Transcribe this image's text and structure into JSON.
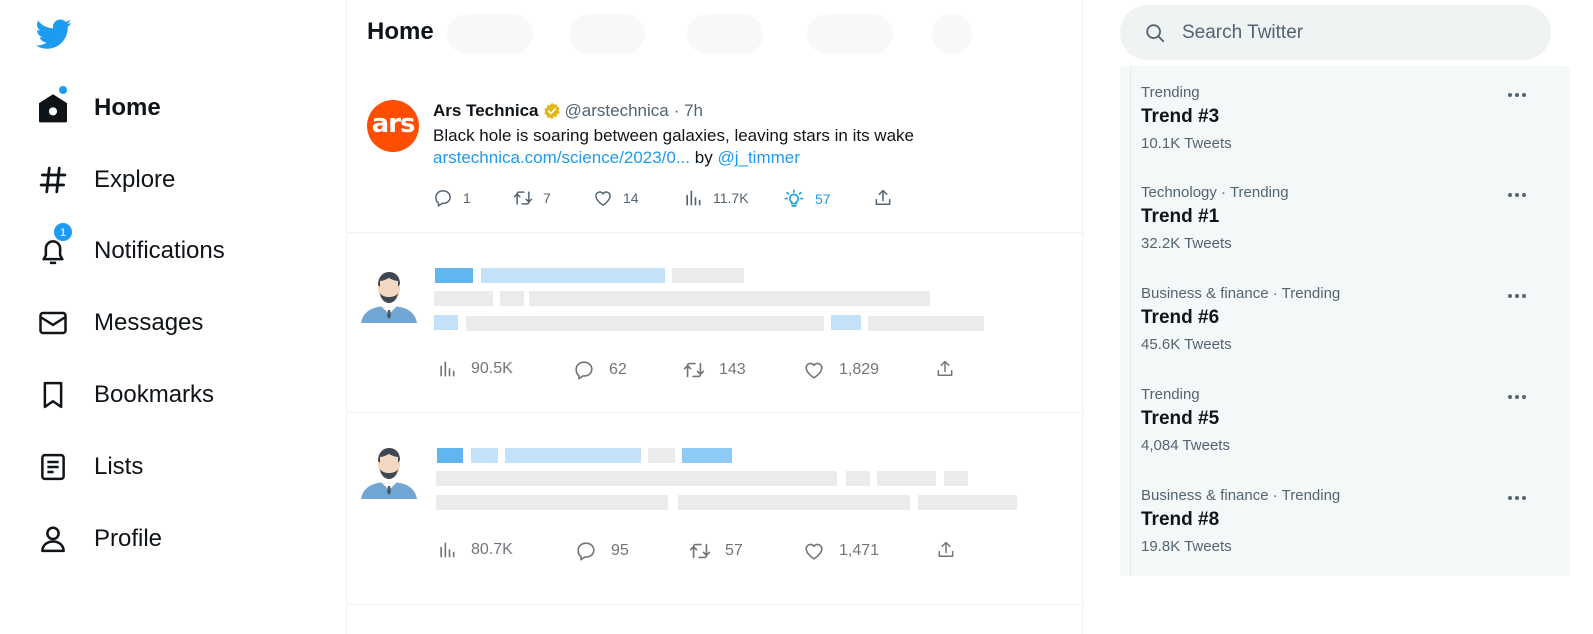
{
  "colors": {
    "accent": "#1d9bf0",
    "ars_orange": "#ff4e00",
    "muted": "#536471"
  },
  "sidebar": {
    "logo_icon": "twitter-bird-icon",
    "items": [
      {
        "label": "Home",
        "icon": "home-icon",
        "active": true,
        "dot": true
      },
      {
        "label": "Explore",
        "icon": "hashtag-icon"
      },
      {
        "label": "Notifications",
        "icon": "bell-icon",
        "badge": "1"
      },
      {
        "label": "Messages",
        "icon": "envelope-icon"
      },
      {
        "label": "Bookmarks",
        "icon": "bookmark-icon"
      },
      {
        "label": "Lists",
        "icon": "list-icon"
      },
      {
        "label": "Profile",
        "icon": "person-icon"
      }
    ]
  },
  "main": {
    "title": "Home",
    "tweet": {
      "avatar_text": "ars",
      "name": "Ars Technica",
      "handle": "@arstechnica",
      "time": "· 7h",
      "text": "Black hole is soaring between galaxies, leaving stars in its wake",
      "link": "arstechnica.com/science/2023/0...",
      "by": "by",
      "mention": "@j_timmer",
      "stats": {
        "replies": "1",
        "retweets": "7",
        "likes": "14",
        "views": "11.7K",
        "tips": "57"
      }
    },
    "placeholder_tweets": [
      {
        "views": "90.5K",
        "replies": "62",
        "retweets": "143",
        "likes": "1,829"
      },
      {
        "views": "80.7K",
        "replies": "95",
        "retweets": "57",
        "likes": "1,471"
      }
    ]
  },
  "search": {
    "placeholder": "Search Twitter"
  },
  "trends": [
    {
      "category": "Trending",
      "name": "Trend #3",
      "count": "10.1K Tweets"
    },
    {
      "category": "Technology · Trending",
      "name": "Trend #1",
      "count": "32.2K Tweets"
    },
    {
      "category": "Business & finance · Trending",
      "name": "Trend #6",
      "count": "45.6K Tweets"
    },
    {
      "category": "Trending",
      "name": "Trend #5",
      "count": "4,084 Tweets"
    },
    {
      "category": "Business & finance · Trending",
      "name": "Trend #8",
      "count": "19.8K Tweets"
    }
  ]
}
